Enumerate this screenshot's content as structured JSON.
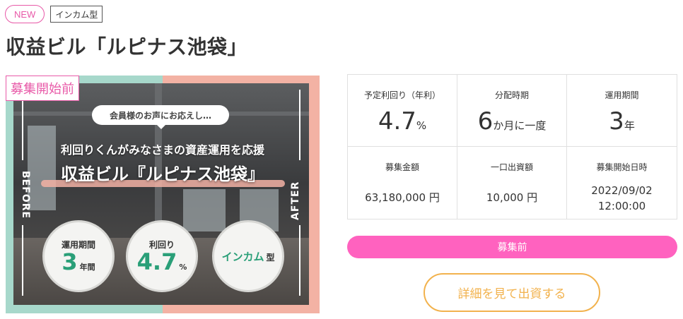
{
  "badges": {
    "new": "NEW",
    "type": "インカム型"
  },
  "title": "収益ビル「ルピナス池袋」",
  "hero": {
    "status_label": "募集開始前",
    "bubble": "会員様のお声にお応えし…",
    "subtitle": "利回りくんがみなさまの資産運用を応援",
    "name": "収益ビル『ルピナス池袋』",
    "before": "BEFORE",
    "after": "AFTER",
    "circles": {
      "period_label": "運用期間",
      "period_value": "3",
      "period_unit": "年間",
      "yield_label": "利回り",
      "yield_value": "4.7",
      "yield_unit": "%",
      "type_main": "インカム",
      "type_suffix": "型"
    }
  },
  "info": {
    "yield": {
      "label": "予定利回り（年利）",
      "value": "4.7",
      "unit": "%"
    },
    "distribution": {
      "label": "分配時期",
      "value": "6",
      "unit": "か月に一度"
    },
    "period": {
      "label": "運用期間",
      "value": "3",
      "unit": "年"
    },
    "amount": {
      "label": "募集金額",
      "value": "63,180,000 円"
    },
    "unit_investment": {
      "label": "一口出資額",
      "value": "10,000 円"
    },
    "start": {
      "label": "募集開始日時",
      "date": "2022/09/02",
      "time": "12:00:00"
    }
  },
  "status": "募集前",
  "cta": "詳細を見て出資する",
  "colors": {
    "pink": "#ff62bf",
    "badge_pink": "#e85aa8",
    "orange": "#f2b24d",
    "green": "#2a9f78",
    "mint": "#a7d8cb",
    "peach": "#f3b2a4"
  }
}
